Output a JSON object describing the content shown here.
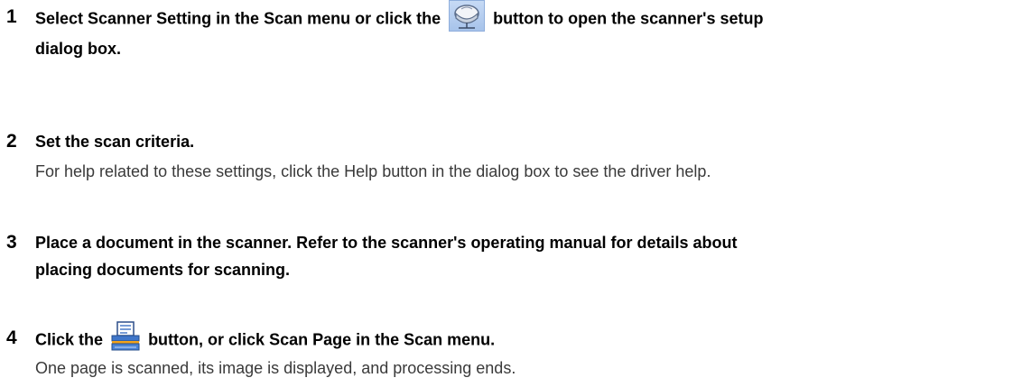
{
  "steps": [
    {
      "number": "1",
      "title_before_icon": "Select Scanner Setting in the Scan menu or click the",
      "title_after_icon": "button to open the scanner's setup",
      "title_line2": "dialog box.",
      "icon": "scanner-setting-icon"
    },
    {
      "number": "2",
      "title": "Set the scan criteria.",
      "description": "For help related to these settings, click the Help button in the dialog box to see the driver help."
    },
    {
      "number": "3",
      "title_line1": "Place a document in the scanner. Refer to the scanner's operating manual for details about",
      "title_line2": "placing documents for scanning."
    },
    {
      "number": "4",
      "title_before_icon": "Click the",
      "title_after_icon": "button, or click Scan Page in the Scan menu.",
      "description": "One page is scanned, its image is displayed, and processing ends.",
      "icon": "scan-page-icon"
    }
  ]
}
